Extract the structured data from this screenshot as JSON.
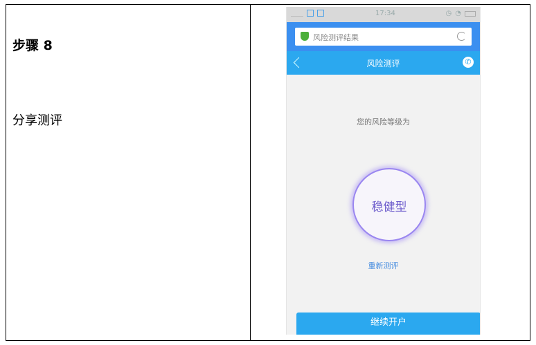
{
  "step": {
    "title": "步骤 8",
    "description": "分享测评"
  },
  "phone": {
    "status_bar": {
      "time": "17:34",
      "left_icons": [
        "signal-icon",
        "sim-icon",
        "app-icon"
      ],
      "right_icons": [
        "alarm-icon",
        "wifi-icon",
        "battery-icon"
      ]
    },
    "url_bar": {
      "text": "风险测评结果",
      "icon": "shield-check-icon",
      "action_icon": "reload-icon"
    },
    "nav": {
      "title": "风险测评",
      "back_icon": "chevron-left-icon",
      "call_icon": "phone-icon"
    },
    "result": {
      "label": "您的风险等级为",
      "level": "稳健型",
      "retest_link": "重新测评"
    },
    "button": {
      "label": "继续开户"
    },
    "colors": {
      "primary": "#2ba8ef",
      "url_bar": "#3b8ff0",
      "circle": "#9a86f0",
      "link": "#4a8fe0"
    }
  }
}
